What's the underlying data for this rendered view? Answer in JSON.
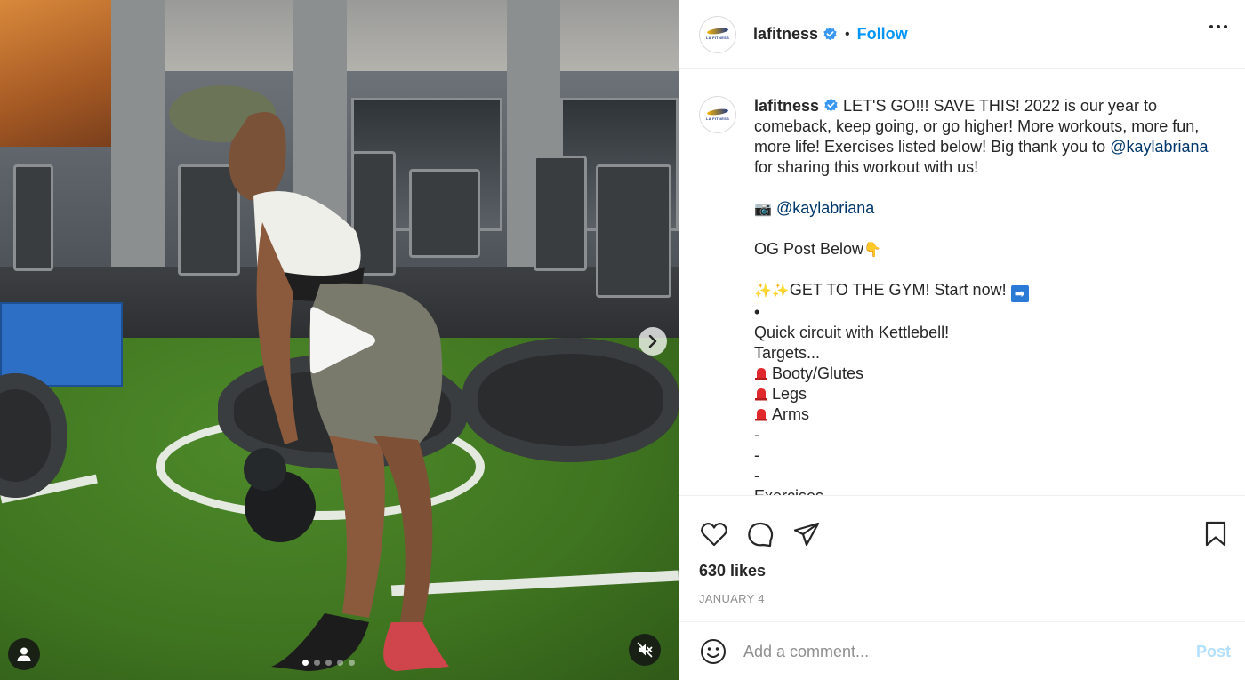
{
  "post": {
    "username": "lafitness",
    "follow_label": "Follow",
    "separator": "•",
    "avatar_brand": "LA FITNESS"
  },
  "caption": {
    "username": "lafitness",
    "line1": "LET'S GO!!! SAVE THIS! 2022 is our year to comeback, keep going, or go higher! More workouts, more fun, more life! Exercises listed below! Big thank you to ",
    "mention1": "@kaylabriana",
    "line1_end": " for sharing this workout with us!",
    "camera_emoji": "📷",
    "mention2": "@kaylabriana",
    "og_post": "OG Post Below",
    "og_emoji": "👇",
    "sparkles": "✨✨",
    "gym_line": "GET TO THE GYM! Start now!",
    "arrow": "➡",
    "bullet": "•",
    "circuit": "Quick circuit with Kettlebell!",
    "targets": "Targets...",
    "target_items": [
      "Booty/Glutes",
      "Legs",
      "Arms"
    ],
    "dashes": [
      "-",
      "-",
      "-"
    ],
    "partial": "Exercises"
  },
  "stats": {
    "likes": "630 likes",
    "date": "JANUARY 4"
  },
  "comment": {
    "placeholder": "Add a comment...",
    "post_label": "Post"
  },
  "media": {
    "carousel_count": 5,
    "active_index": 0,
    "icons": [
      "play-icon",
      "chevron-right-icon",
      "user-tag-icon",
      "muted-speaker-icon"
    ]
  },
  "colors": {
    "accent": "#0095f6",
    "mention": "#00376b",
    "post_disabled": "#b2dffc",
    "verified": "#3897f0"
  }
}
